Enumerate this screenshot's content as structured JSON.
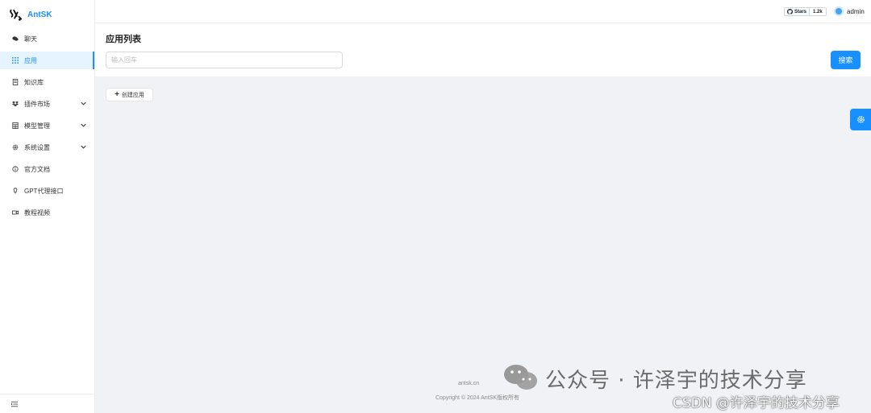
{
  "app": {
    "title": "AntSK"
  },
  "sidebar": {
    "items": [
      {
        "label": "聊天",
        "icon": "chat-icon",
        "active": false,
        "expandable": false
      },
      {
        "label": "应用",
        "icon": "apps-icon",
        "active": true,
        "expandable": false
      },
      {
        "label": "知识库",
        "icon": "book-icon",
        "active": false,
        "expandable": false
      },
      {
        "label": "插件市场",
        "icon": "dropbox-icon",
        "active": false,
        "expandable": true
      },
      {
        "label": "模型管理",
        "icon": "calculator-icon",
        "active": false,
        "expandable": true
      },
      {
        "label": "系统设置",
        "icon": "settings-icon",
        "active": false,
        "expandable": true
      },
      {
        "label": "官方文档",
        "icon": "info-icon",
        "active": false,
        "expandable": false
      },
      {
        "label": "GPT代理接口",
        "icon": "bulb-icon",
        "active": false,
        "expandable": false
      },
      {
        "label": "教程视频",
        "icon": "video-icon",
        "active": false,
        "expandable": false
      }
    ]
  },
  "header": {
    "github": {
      "label": "Stars",
      "count": "1.2k"
    },
    "user": "admin"
  },
  "main": {
    "title": "应用列表",
    "search_placeholder": "输入回车",
    "search_button": "搜索",
    "create_button": "创建应用"
  },
  "footer": {
    "link": "antsk.cn",
    "copyright": "Copyright © 2024 AntSK版权所有"
  },
  "watermark": {
    "line1": "公众号 · 许泽宇的技术分享",
    "line2": "CSDN @许泽宇的技术分享"
  },
  "colors": {
    "accent": "#1890ff",
    "background": "#f0f2f5"
  }
}
